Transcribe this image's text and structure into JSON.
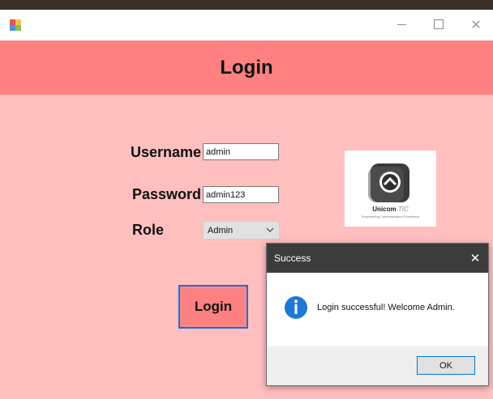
{
  "window": {
    "app_icon": "winforms-app-icon",
    "controls": {
      "minimize": "minimize-icon",
      "maximize": "maximize-icon",
      "close": "close-icon"
    }
  },
  "header": {
    "title": "Login"
  },
  "form": {
    "username_label": "Username",
    "username_value": "admin",
    "password_label": "Password",
    "password_value": "admin123",
    "role_label": "Role",
    "role_value": "Admin",
    "login_button": "Login"
  },
  "logo": {
    "brand": "Unicom",
    "brand_suffix": "TIC",
    "tagline": "Empowering Communication Excellence"
  },
  "dialog": {
    "title": "Success",
    "message": "Login successful! Welcome Admin.",
    "ok_label": "OK",
    "icon": "info-icon"
  },
  "colors": {
    "header_band": "#ff8080",
    "form_background": "#ffbfbf",
    "login_button": "#ff8080",
    "dialog_titlebar": "#3c3c3c",
    "info_icon": "#1e78d7"
  }
}
